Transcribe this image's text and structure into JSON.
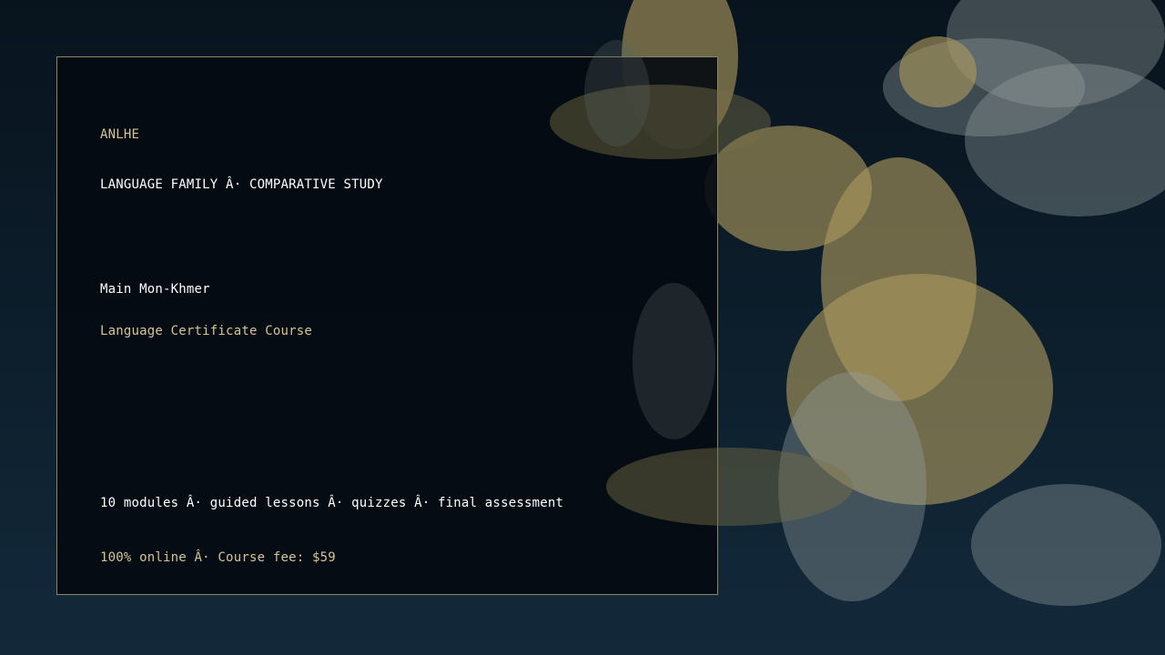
{
  "card": {
    "eyebrow": "ANLHE",
    "category": "LANGUAGE FAMILY Â· COMPARATIVE STUDY",
    "language": "Main Mon-Khmer",
    "course_type": "Language Certificate Course",
    "features": "10 modules Â· guided lessons Â· quizzes Â· final assessment",
    "pricing": "100% online Â· Course fee: $59"
  },
  "colors": {
    "gold_text": "#d8c493",
    "white_text": "#ffffff",
    "card_border": "#8b8466"
  }
}
